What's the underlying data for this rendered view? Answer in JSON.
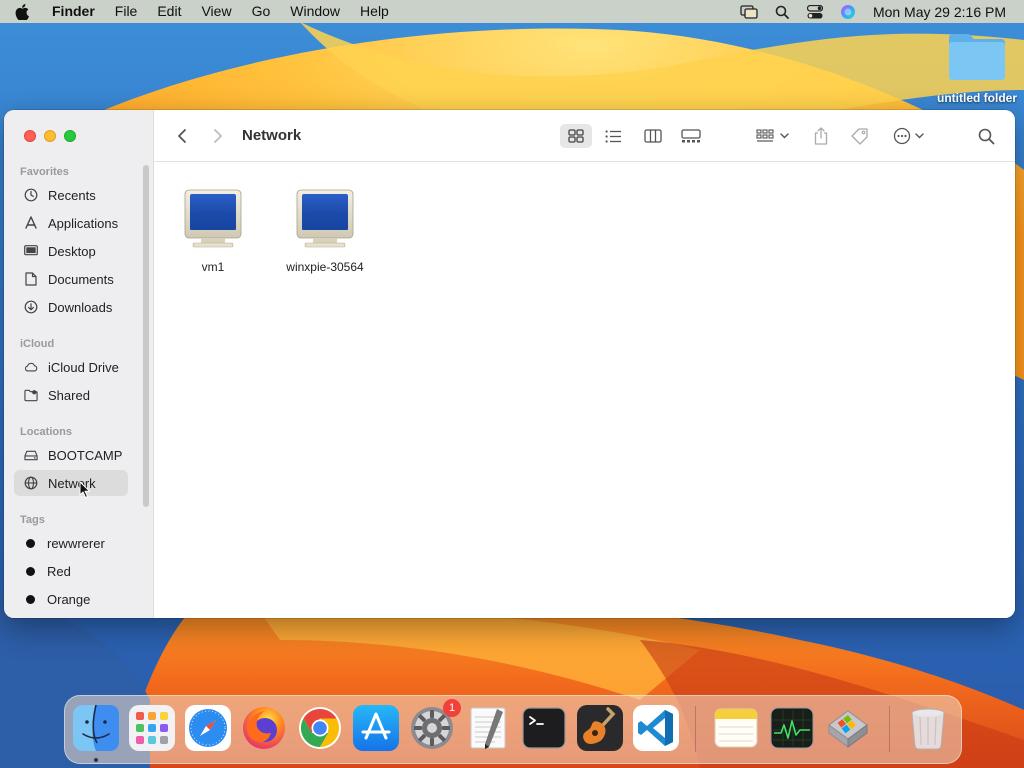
{
  "menubar": {
    "apple_icon": "apple-logo-icon",
    "app_name": "Finder",
    "menus": [
      "File",
      "Edit",
      "View",
      "Go",
      "Window",
      "Help"
    ],
    "tray_icons": [
      "screen-mirroring-icon",
      "spotlight-search-icon",
      "control-center-icon",
      "siri-icon"
    ],
    "clock": "Mon May 29  2:16 PM"
  },
  "desktop": {
    "folder_label": "untitled folder"
  },
  "finder": {
    "title": "Network",
    "sidebar": {
      "favorites_header": "Favorites",
      "favorites": [
        {
          "label": "Recents",
          "icon": "clock-icon"
        },
        {
          "label": "Applications",
          "icon": "applications-icon"
        },
        {
          "label": "Desktop",
          "icon": "desktop-icon"
        },
        {
          "label": "Documents",
          "icon": "document-icon"
        },
        {
          "label": "Downloads",
          "icon": "download-icon"
        }
      ],
      "icloud_header": "iCloud",
      "icloud": [
        {
          "label": "iCloud Drive",
          "icon": "cloud-icon"
        },
        {
          "label": "Shared",
          "icon": "shared-folder-icon"
        }
      ],
      "locations_header": "Locations",
      "locations": [
        {
          "label": "BOOTCAMP",
          "icon": "drive-icon"
        },
        {
          "label": "Network",
          "icon": "globe-icon",
          "selected": true
        }
      ],
      "tags_header": "Tags",
      "tags": [
        {
          "label": "rewwrerer",
          "color": "#111111"
        },
        {
          "label": "Red",
          "color": "#111111"
        },
        {
          "label": "Orange",
          "color": "#111111"
        }
      ]
    },
    "toolbar": {
      "view_modes": [
        "icon-view",
        "list-view",
        "column-view",
        "gallery-view"
      ],
      "active_view": "icon-view",
      "tools": [
        "group-by",
        "share",
        "tags",
        "more-actions",
        "search"
      ]
    },
    "items": [
      {
        "label": "vm1",
        "icon": "network-computer-icon"
      },
      {
        "label": "winxpie-30564",
        "icon": "network-computer-icon"
      }
    ]
  },
  "dock": {
    "apps": [
      "Finder",
      "Launchpad",
      "Safari",
      "Firefox",
      "Chrome",
      "App Store",
      "System Settings",
      "TextEdit",
      "Terminal",
      "GarageBand",
      "Visual Studio Code",
      "Notes",
      "Activity Monitor",
      "Boot Camp Assistant",
      "Trash"
    ],
    "settings_badge": "1"
  },
  "colors": {
    "accent_selected": "#dcdcdc",
    "close": "#ff5f57",
    "minimize": "#febc2e",
    "zoom": "#28c840",
    "badge": "#f2413a"
  }
}
